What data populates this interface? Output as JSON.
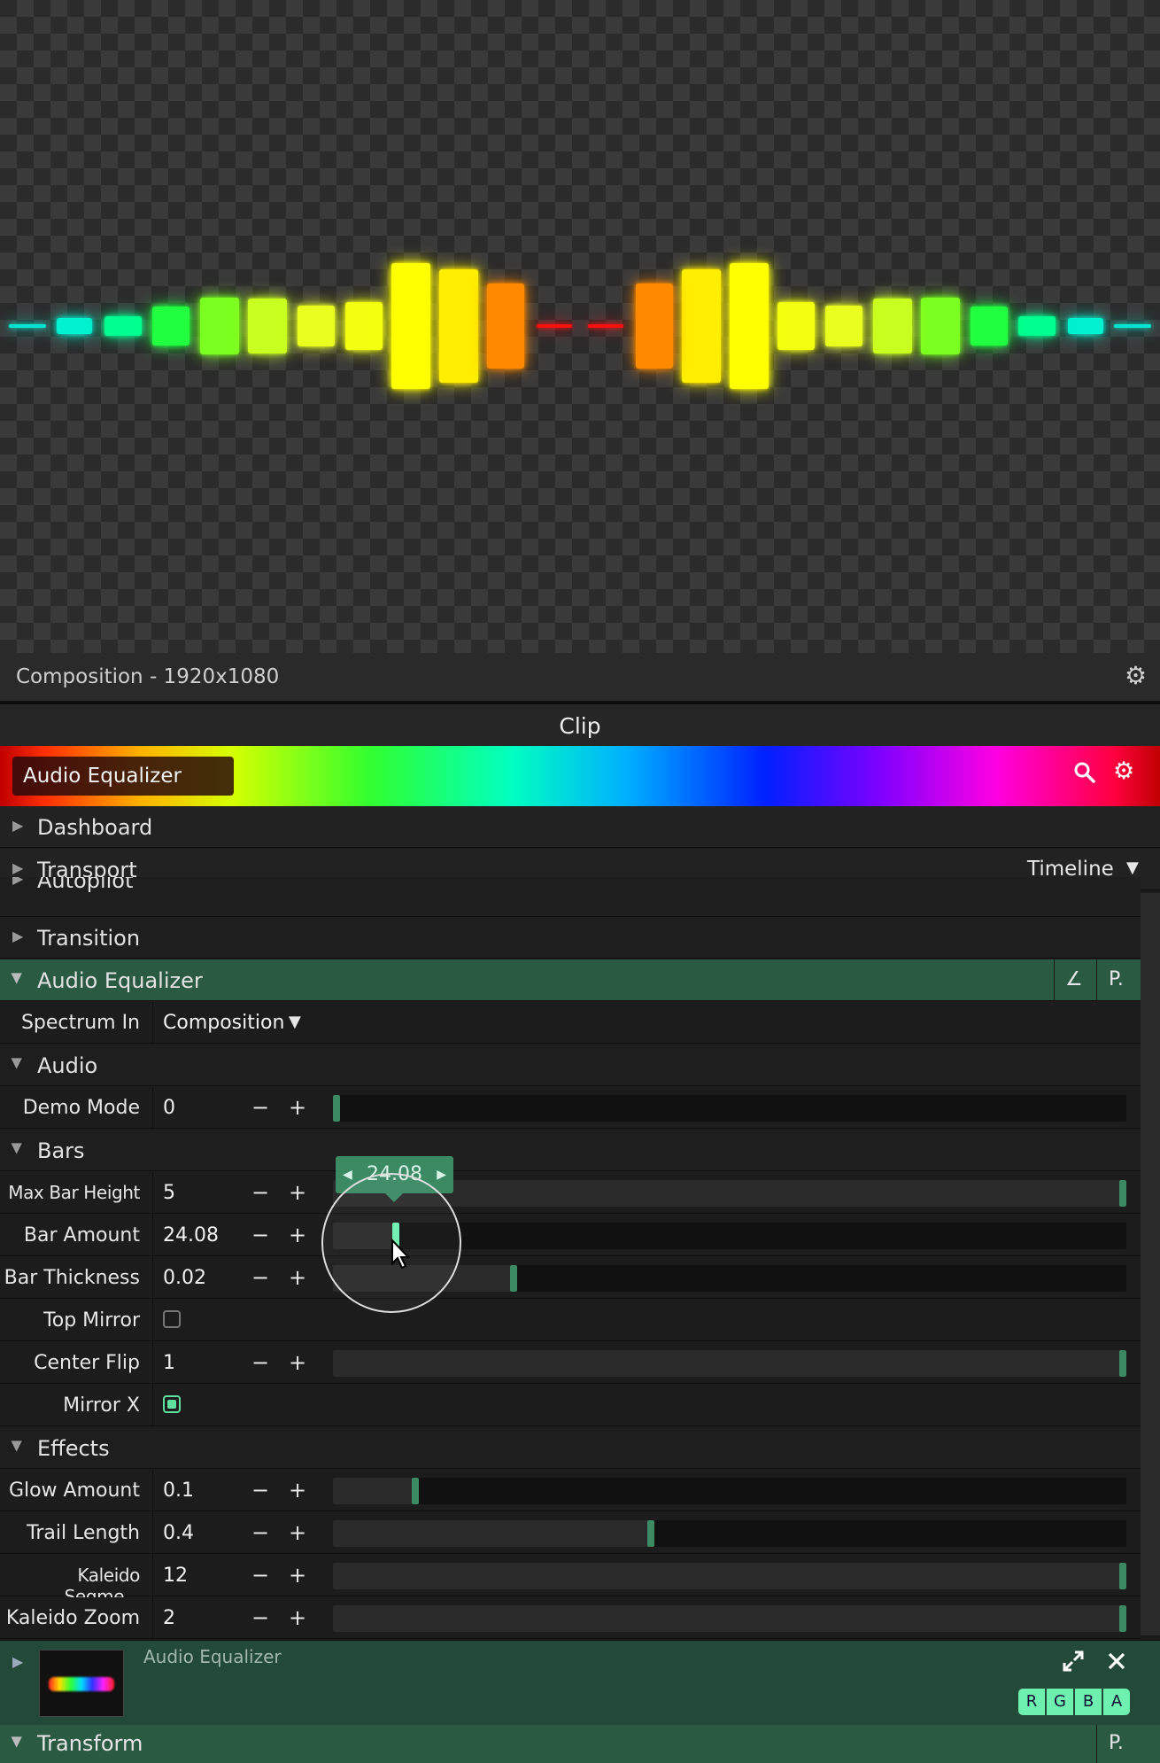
{
  "composition": {
    "title": "Composition - 1920x1080"
  },
  "clip": {
    "header": "Clip",
    "name": "Audio Equalizer"
  },
  "sections_top": [
    {
      "label": "Dashboard"
    },
    {
      "label": "Transport",
      "dropdown": "Timeline"
    },
    {
      "label": "Autopilot"
    },
    {
      "label": "Transition"
    }
  ],
  "effect": {
    "title": "Audio Equalizer",
    "edit_label": "∠",
    "preset_label": "P.",
    "spectrum_in_label": "Spectrum In",
    "spectrum_in_value": "Composition"
  },
  "groups": {
    "audio": "Audio",
    "bars": "Bars",
    "effects": "Effects"
  },
  "params": {
    "demo_mode": {
      "label": "Demo Mode",
      "value": "0",
      "level": 0.0
    },
    "max_bar_height": {
      "label": "Max Bar Height",
      "value": "5",
      "level": 1.0
    },
    "bar_amount": {
      "label": "Bar Amount",
      "value": "24.08",
      "level": 0.075
    },
    "bar_thickness": {
      "label": "Bar Thickness",
      "value": "0.02",
      "level": 0.225
    },
    "top_mirror": {
      "label": "Top Mirror",
      "checked": false
    },
    "center_flip": {
      "label": "Center Flip",
      "value": "1",
      "level": 1.0
    },
    "mirror_x": {
      "label": "Mirror X",
      "checked": true
    },
    "glow_amount": {
      "label": "Glow Amount",
      "value": "0.1",
      "level": 0.1
    },
    "trail_length": {
      "label": "Trail Length",
      "value": "0.4",
      "level": 0.4
    },
    "kaleido_segments": {
      "label": "Kaleido Segme...",
      "value": "12",
      "level": 1.0
    },
    "kaleido_zoom": {
      "label": "Kaleido Zoom",
      "value": "2",
      "level": 1.0
    }
  },
  "stepper": {
    "minus": "−",
    "plus": "+"
  },
  "tooltip": {
    "value": "24.08"
  },
  "layer": {
    "name": "Audio Equalizer",
    "channels": [
      "R",
      "G",
      "B",
      "A"
    ]
  },
  "transform": {
    "label": "Transform",
    "preset_label": "P."
  },
  "colors": {
    "accent": "#3b8a64",
    "effect_header": "#2b5a43",
    "layer_bg": "#234a38",
    "channel_active": "#6ef0b0"
  },
  "icons": {
    "gear": "gear-icon",
    "search": "search-icon",
    "expand": "expand-icon",
    "close": "close-icon"
  }
}
